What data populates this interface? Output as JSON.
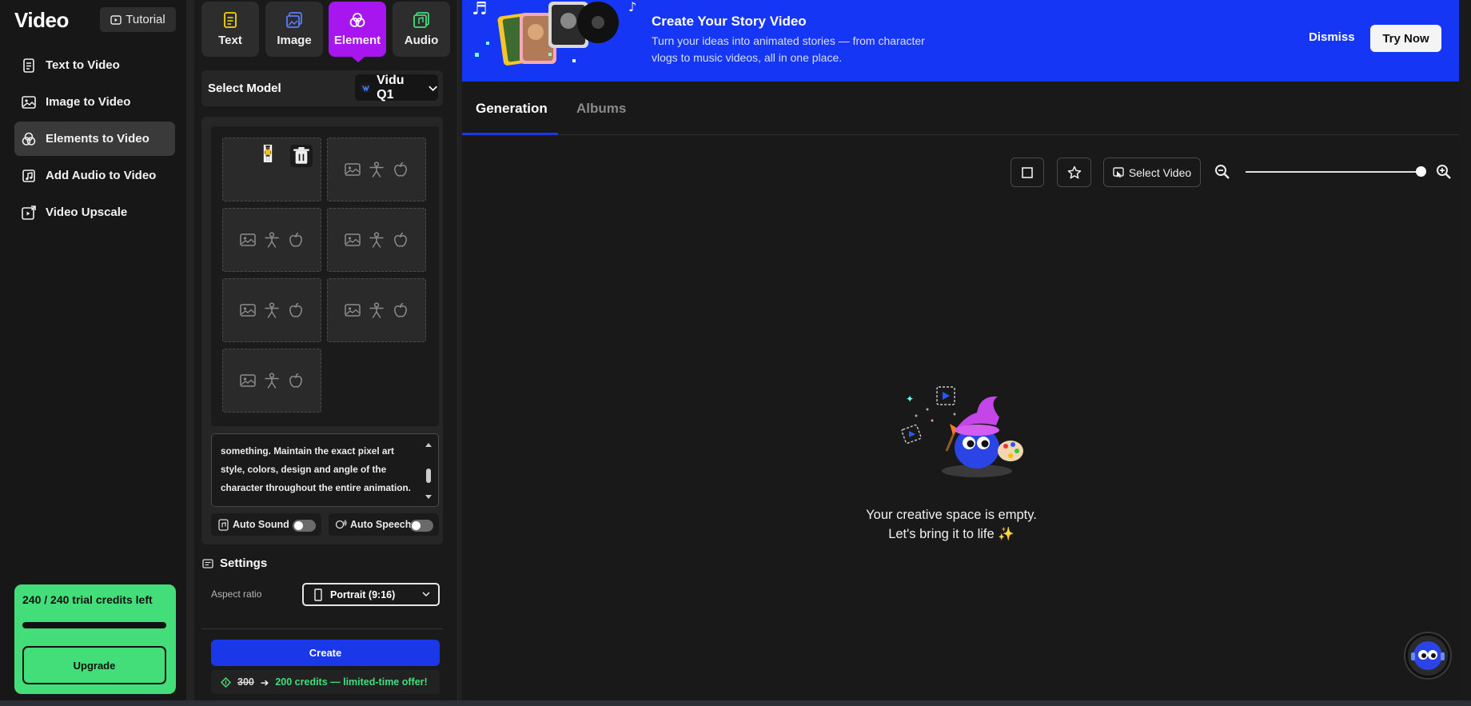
{
  "left_nav": {
    "brand": "Video",
    "tutorial_label": "Tutorial",
    "items": [
      {
        "label": "Text to Video",
        "icon": "document-icon",
        "active": false
      },
      {
        "label": "Image to Video",
        "icon": "image-icon",
        "active": false
      },
      {
        "label": "Elements to Video",
        "icon": "elements-icon",
        "active": true
      },
      {
        "label": "Add Audio to Video",
        "icon": "audio-file-icon",
        "active": false
      },
      {
        "label": "Video Upscale",
        "icon": "upscale-icon",
        "active": false
      }
    ],
    "credits": {
      "text": "240 / 240 trial credits left",
      "fraction_remaining": 1.0,
      "upgrade_label": "Upgrade"
    }
  },
  "mode_tabs": [
    {
      "label": "Text",
      "icon_color": "#f5d20a",
      "active": false
    },
    {
      "label": "Image",
      "icon_color": "#5a7cff",
      "active": false
    },
    {
      "label": "Element",
      "icon_color": "#ffffff",
      "active": true
    },
    {
      "label": "Audio",
      "icon_color": "#43de79",
      "active": false
    }
  ],
  "model": {
    "label": "Select Model",
    "value": "Vidu Q1"
  },
  "prompt_text": "something. Maintain the exact pixel art style, colors, design and angle of the character throughout the entire animation.",
  "toggles": {
    "auto_sound": "Auto Sound",
    "auto_speech": "Auto Speech"
  },
  "settings": {
    "heading": "Settings",
    "aspect_label": "Aspect ratio",
    "aspect_value": "Portrait (9:16)"
  },
  "create": {
    "label": "Create",
    "old_price": "300",
    "offer": "200 credits — limited-time offer!"
  },
  "banner": {
    "title": "Create Your Story Video",
    "subtitle": "Turn your ideas into animated stories — from character vlogs to music videos, all in one place.",
    "dismiss_label": "Dismiss",
    "cta_label": "Try Now"
  },
  "tabs": [
    {
      "label": "Generation",
      "active": true
    },
    {
      "label": "Albums",
      "active": false
    }
  ],
  "toolbar": {
    "select_video_label": "Select Video",
    "zoom_fraction": 1.0
  },
  "empty_state": {
    "line1": "Your creative space is empty.",
    "line2": "Let's bring it to life ✨"
  },
  "colors": {
    "accent_blue": "#1a37e8",
    "banner_blue": "#1537f5",
    "element_purple": "#a716ef",
    "credit_green": "#43de79"
  }
}
